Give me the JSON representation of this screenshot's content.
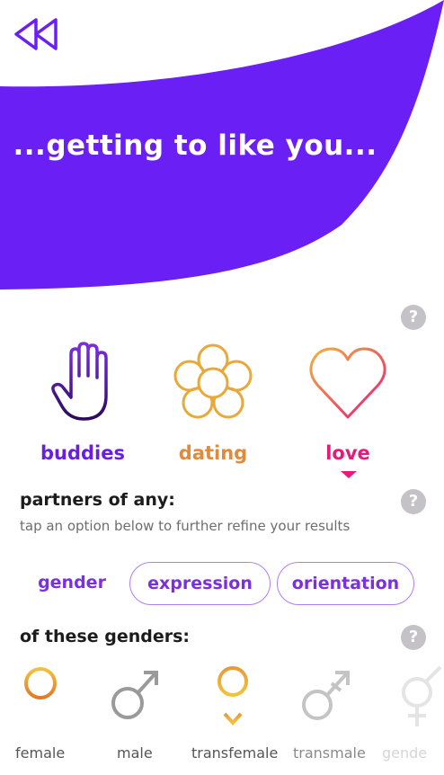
{
  "header": {
    "title": "...getting to like you...",
    "back_icon": "rewind-icon",
    "banner_color": "#6a1ff5"
  },
  "relationship": {
    "options": [
      {
        "label": "buddies",
        "icon": "hand-icon",
        "color": "#6a1fe0"
      },
      {
        "label": "dating",
        "icon": "flower-icon",
        "color": "#e08a3c"
      },
      {
        "label": "love",
        "icon": "heart-icon",
        "color": "#e8197a",
        "selected": true
      }
    ]
  },
  "partners": {
    "title": "partners of any:",
    "subtitle": "tap an option below to further refine your results",
    "tabs": [
      "gender",
      "expression",
      "orientation"
    ],
    "active_tab": "gender"
  },
  "genders": {
    "title": "of these genders:",
    "items": [
      {
        "label": "female",
        "icon": "female-symbol-icon"
      },
      {
        "label": "male",
        "icon": "male-symbol-icon"
      },
      {
        "label": "transfemale",
        "icon": "transfemale-symbol-icon"
      },
      {
        "label": "transmale",
        "icon": "transmale-symbol-icon"
      },
      {
        "label": "gende",
        "icon": "genderqueer-symbol-icon"
      }
    ]
  },
  "help_icon": "?"
}
